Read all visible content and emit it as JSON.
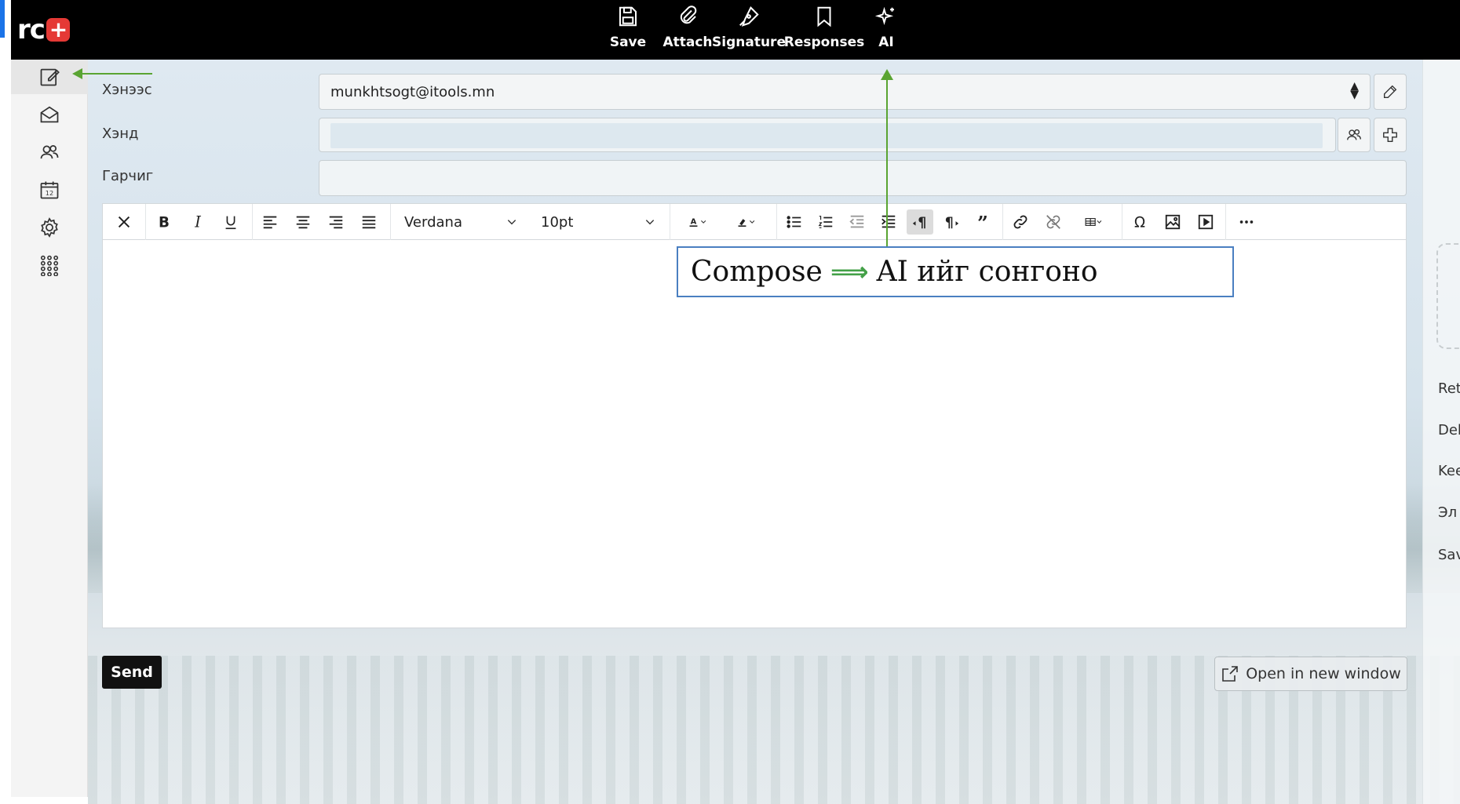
{
  "app": {
    "logo_text": "rc",
    "logo_plus": "+"
  },
  "toolbar": {
    "items": [
      {
        "label": "Save",
        "icon": "save-icon"
      },
      {
        "label": "Attach",
        "icon": "paperclip-icon"
      },
      {
        "label": "Signature",
        "icon": "pen-icon"
      },
      {
        "label": "Responses",
        "icon": "bookmark-icon"
      },
      {
        "label": "AI",
        "icon": "sparkle-icon"
      }
    ]
  },
  "sidebar": {
    "items": [
      {
        "icon": "compose-icon",
        "active": true
      },
      {
        "icon": "mail-icon"
      },
      {
        "icon": "contacts-icon"
      },
      {
        "icon": "calendar-icon",
        "badge": "12"
      },
      {
        "icon": "gear-icon"
      },
      {
        "icon": "apps-grid-icon"
      }
    ]
  },
  "form": {
    "from_label": "Хэнээс",
    "from_value": "munkhtsogt@itools.mn",
    "to_label": "Хэнд",
    "to_value": "",
    "subject_label": "Гарчиг",
    "subject_value": ""
  },
  "editor": {
    "font_family": "Verdana",
    "font_size": "10pt"
  },
  "annotation": {
    "before": "Compose",
    "arrow": "⟹",
    "after": "AI ийг сонгоно"
  },
  "actions": {
    "send_label": "Send",
    "open_new_window_label": "Open in new window"
  },
  "right_panel": {
    "items": [
      "Ret",
      "Deli",
      "Kee",
      "Эл",
      "Sav"
    ]
  },
  "colors": {
    "topbar": "#000000",
    "annotation_arrow": "#5aa432",
    "annotation_border": "#4a7fc1",
    "logo_plus": "#e53935"
  }
}
